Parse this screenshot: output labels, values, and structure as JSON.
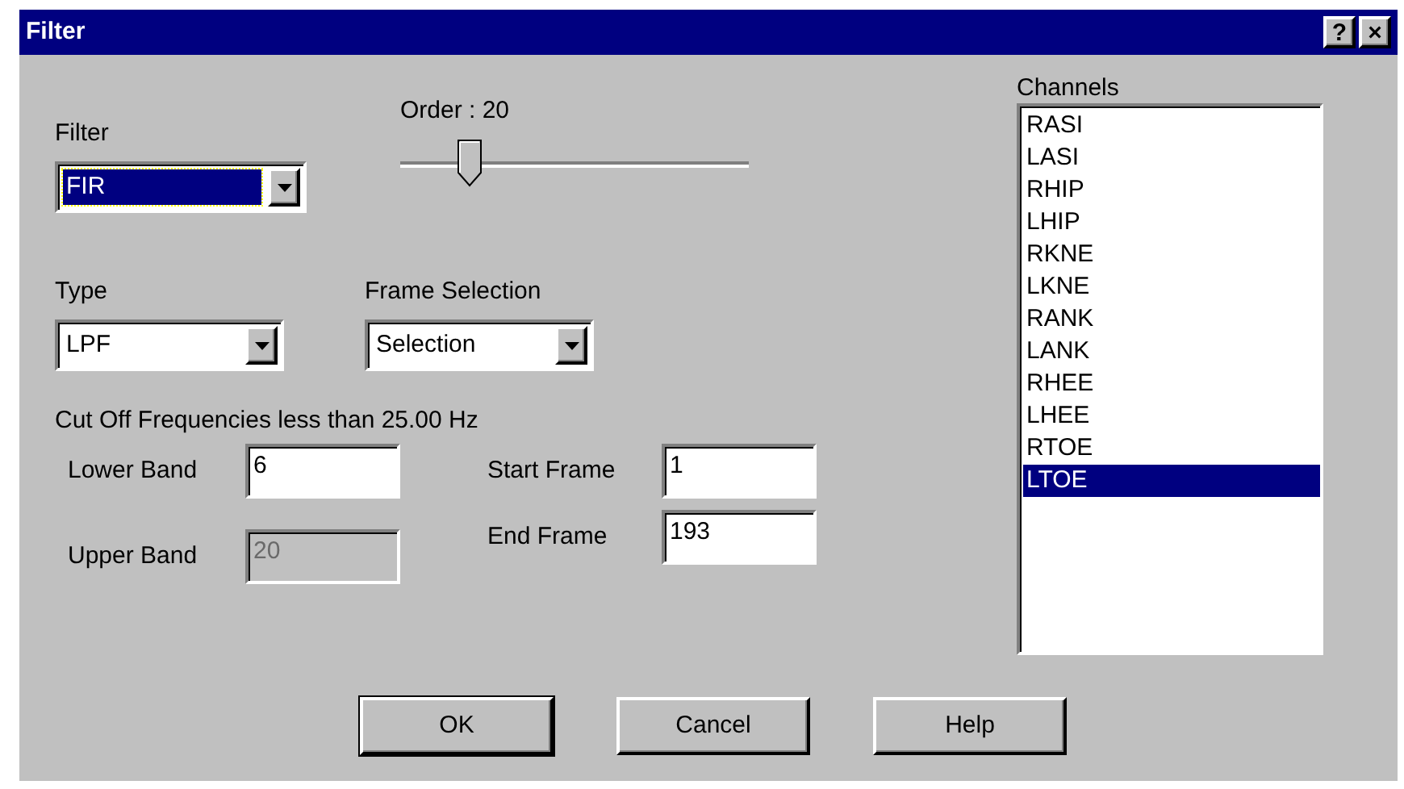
{
  "window": {
    "title": "Filter",
    "title_buttons": [
      "?",
      "×"
    ]
  },
  "filter": {
    "label": "Filter",
    "value": "FIR",
    "focused": true
  },
  "order": {
    "label": "Order : 20",
    "level": 0.2
  },
  "type": {
    "label": "Type",
    "value": "LPF",
    "focused": false
  },
  "frame_selection": {
    "label": "Frame Selection",
    "value": "Selection",
    "focused": false
  },
  "cutoff_text": "Cut Off Frequencies less than 25.00 Hz",
  "fields": [
    {
      "label": "Lower Band",
      "value": "6",
      "disabled": false
    },
    {
      "label": "Upper Band",
      "value": "20",
      "disabled": true
    },
    {
      "label": "Start Frame",
      "value": "1",
      "disabled": false
    },
    {
      "label": "End Frame",
      "value": "193",
      "disabled": false
    }
  ],
  "channels": {
    "label": "Channels",
    "items": [
      {
        "name": "RASI",
        "selected": false
      },
      {
        "name": "LASI",
        "selected": false
      },
      {
        "name": "RHIP",
        "selected": false
      },
      {
        "name": "LHIP",
        "selected": false
      },
      {
        "name": "RKNE",
        "selected": false
      },
      {
        "name": "LKNE",
        "selected": false
      },
      {
        "name": "RANK",
        "selected": false
      },
      {
        "name": "LANK",
        "selected": false
      },
      {
        "name": "RHEE",
        "selected": false
      },
      {
        "name": "LHEE",
        "selected": false
      },
      {
        "name": "RTOE",
        "selected": false
      },
      {
        "name": "LTOE",
        "selected": true
      }
    ]
  },
  "buttons": [
    {
      "label": "OK",
      "default": true
    },
    {
      "label": "Cancel",
      "default": false
    },
    {
      "label": "Help",
      "default": false
    }
  ]
}
